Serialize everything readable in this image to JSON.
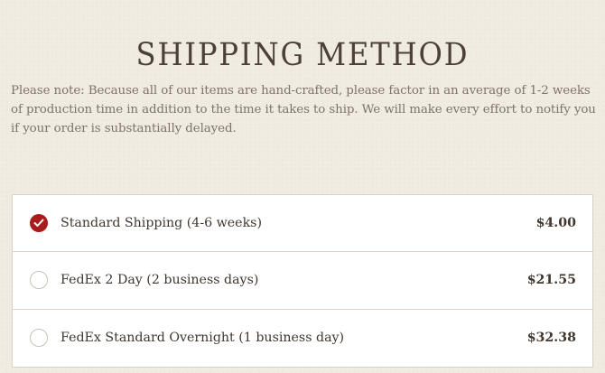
{
  "header": {
    "title": "SHIPPING METHOD"
  },
  "note": "Please note: Because all of our items are hand-crafted, please factor in an average of 1-2 weeks of production time in addition to the time it takes to ship. We will make every effort to notify you if your order is substantially delayed.",
  "shipping_options": [
    {
      "label": "Standard Shipping (4-6 weeks)",
      "price": "$4.00",
      "selected": true
    },
    {
      "label": "FedEx 2 Day (2 business days)",
      "price": "$21.55",
      "selected": false
    },
    {
      "label": "FedEx Standard Overnight (1 business day)",
      "price": "$32.38",
      "selected": false
    }
  ],
  "colors": {
    "accent": "#a81c1c",
    "background": "#f1ece3",
    "text": "#3f362f"
  },
  "icons": {
    "selected": "checkmark-icon"
  }
}
